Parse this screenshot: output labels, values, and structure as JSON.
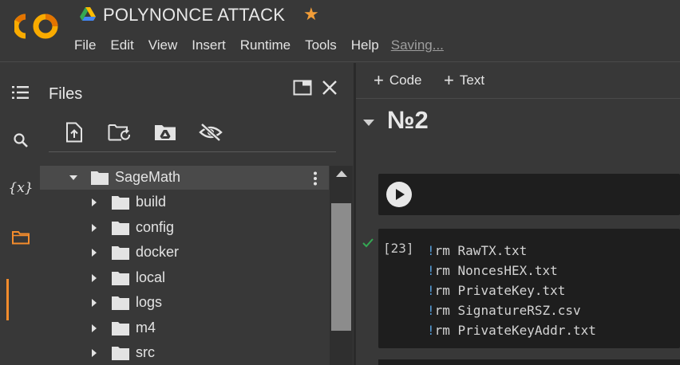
{
  "app": {
    "logo_text": "CO",
    "title": "POLYNONCE ATTACK",
    "colors": {
      "logo": "#f9ab00",
      "star": "#f29d38",
      "accent": "#f48c2c"
    }
  },
  "menu": {
    "items": [
      "File",
      "Edit",
      "View",
      "Insert",
      "Runtime",
      "Tools",
      "Help"
    ],
    "status": "Saving..."
  },
  "rail": {
    "items": [
      {
        "icon": "table-of-contents-icon"
      },
      {
        "icon": "search-icon"
      },
      {
        "icon": "variables-icon",
        "label": "{x}"
      },
      {
        "icon": "folder-icon",
        "active": true
      }
    ]
  },
  "files_panel": {
    "title": "Files",
    "toolbar": [
      "upload-file-icon",
      "refresh-folder-icon",
      "mount-drive-icon",
      "toggle-hidden-icon"
    ],
    "tree": [
      {
        "label": "SageMath",
        "expanded": true,
        "selected": true,
        "depth": 0
      },
      {
        "label": "build",
        "depth": 1
      },
      {
        "label": "config",
        "depth": 1
      },
      {
        "label": "docker",
        "depth": 1
      },
      {
        "label": "local",
        "depth": 1
      },
      {
        "label": "logs",
        "depth": 1
      },
      {
        "label": "m4",
        "depth": 1
      },
      {
        "label": "src",
        "depth": 1
      }
    ]
  },
  "notebook": {
    "toolbar": {
      "add_code": "Code",
      "add_text": "Text",
      "plus": "+"
    },
    "section_title": "№2",
    "code_cell": {
      "execution_count": "[23]",
      "status": "success",
      "lines": [
        {
          "bang": "!",
          "cmd": "rm RawTX.txt"
        },
        {
          "bang": "!",
          "cmd": "rm NoncesHEX.txt"
        },
        {
          "bang": "!",
          "cmd": "rm PrivateKey.txt"
        },
        {
          "bang": "!",
          "cmd": "rm SignatureRSZ.csv"
        },
        {
          "bang": "!",
          "cmd": "rm PrivateKeyAddr.txt"
        }
      ]
    }
  }
}
